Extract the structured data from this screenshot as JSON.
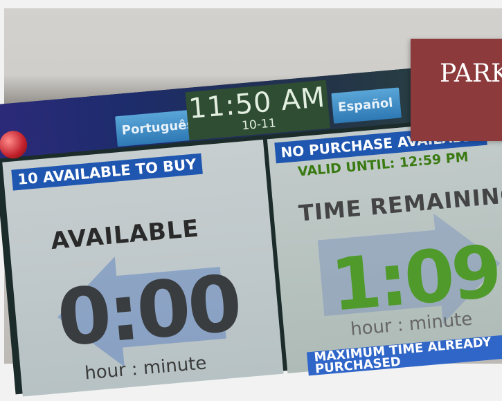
{
  "clock": {
    "time": "11:50 AM",
    "date": "10-11"
  },
  "languages": {
    "left": "Português",
    "right": "Español"
  },
  "left_panel": {
    "banner": "10 AVAILABLE TO BUY",
    "heading": "AVAILABLE",
    "time": "0:00",
    "unit": "hour : minute"
  },
  "right_panel": {
    "banner": "NO PURCHASE AVAILABLE",
    "valid_until": "VALID UNTIL: 12:59 PM",
    "heading": "TIME REMAINING",
    "time": "1:09",
    "unit": "hour : minute",
    "bottom_banner_line1": "MAXIMUM TIME ALREADY",
    "bottom_banner_line2": "PURCHASED"
  },
  "sign": {
    "text": "PARK"
  },
  "colors": {
    "sign_bg": "#8c3a3b",
    "banner_blue": "#1f56b0",
    "remaining_green": "#4f9a2a",
    "clock_green": "#2f4d33"
  }
}
